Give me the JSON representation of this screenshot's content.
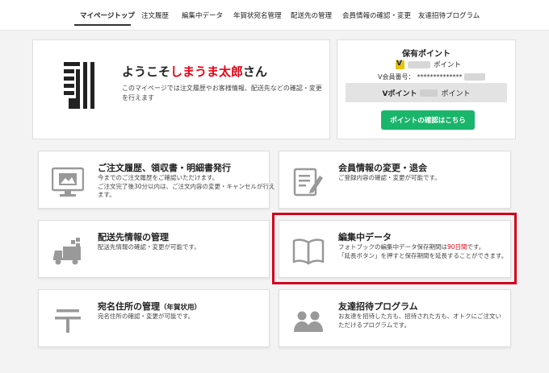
{
  "nav": {
    "items": [
      {
        "label": "マイページトップ",
        "active": true
      },
      {
        "label": "注文履歴"
      },
      {
        "label": "編集中データ"
      },
      {
        "label": "年賀状宛名管理"
      },
      {
        "label": "配送先の管理"
      },
      {
        "label": "会員情報の確認・変更"
      },
      {
        "label": "友達招待プログラム"
      }
    ]
  },
  "welcome": {
    "prefix": "ようこそ",
    "name": "しまうま太郎",
    "suffix": "さん",
    "description": "このマイページでは注文履歴やお客様情報、配送先などの確認・変更を行えます"
  },
  "points": {
    "title": "保有ポイント",
    "point_unit": "ポイント",
    "member_label": "V会員番号：",
    "member_masked": "**************",
    "vpoint_label": "Vポイント",
    "vpoint_unit": "ポイント",
    "check_button": "ポイントの確認はこちら"
  },
  "cards": {
    "orders": {
      "title": "ご注文履歴、領収書・明細書発行",
      "desc1": "今までのご注文履歴をご確認いただけます。",
      "desc2": "ご注文完了後30分以内は、ご注文内容の変更・キャンセルが行えます。"
    },
    "member": {
      "title": "会員情報の変更・退会",
      "desc1": "ご登録内容の確認・変更が可能です。"
    },
    "shipping": {
      "title": "配送先情報の管理",
      "desc1": "配送先情報の確認・変更が可能です。"
    },
    "editing": {
      "title": "編集中データ",
      "desc1_pre": "フォトブックの編集中データ保存期間は",
      "desc1_red": "90日間",
      "desc1_post": "です。",
      "desc2": "「延長ボタン」を押すと保存期間を延長することができます。"
    },
    "address": {
      "title": "宛名住所の管理",
      "title_sub": "（年賀状用）",
      "desc1": "宛名住所の確認・変更が可能です。"
    },
    "invite": {
      "title": "友達招待プログラム",
      "desc1": "お友達を招待した方も、招待された方も、オトクにご注文いただけるプログラムです。"
    }
  },
  "colors": {
    "accent_red": "#e60012",
    "button_green": "#19b56b",
    "highlight_border": "#d0021b"
  }
}
